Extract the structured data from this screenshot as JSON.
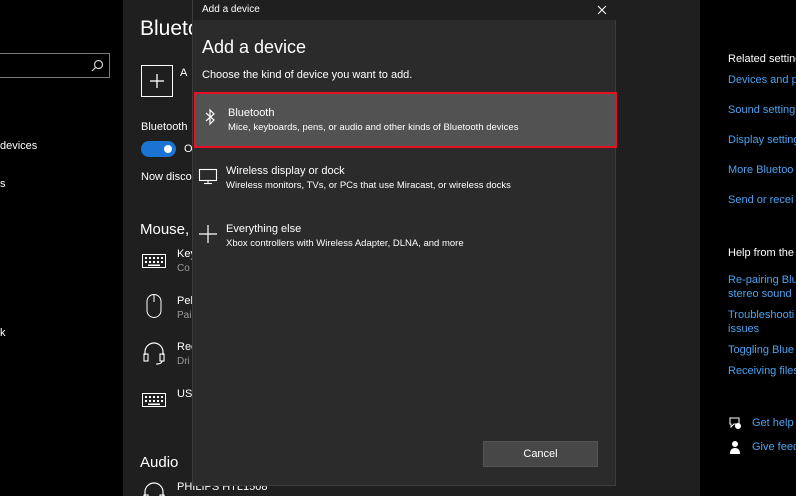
{
  "left_nav": {
    "items": [
      "devices",
      "s",
      "k"
    ]
  },
  "main": {
    "title": "Bluetooth",
    "add_label": "A",
    "bluetooth_label": "Bluetooth",
    "toggle_state": "O",
    "now_discoverable": "Now disco",
    "mouse_section": "Mouse,",
    "devices": [
      {
        "name": "Key",
        "sub": "Co",
        "icon": "keyboard-icon"
      },
      {
        "name": "Peb",
        "sub": "Pai",
        "icon": "mouse-icon"
      },
      {
        "name": "Rec",
        "sub": "Dri",
        "icon": "headset-icon"
      },
      {
        "name": "USI",
        "sub": "",
        "icon": "keyboard-icon"
      }
    ],
    "audio_section": "Audio",
    "audio_device": {
      "name": "PHILIPS HTL1508",
      "icon": "headphones-icon"
    }
  },
  "right_col": {
    "related_head": "Related setting",
    "related_links": [
      "Devices and p",
      "Sound setting",
      "Display setting",
      "More Bluetoo",
      "Send or recei"
    ],
    "help_head": "Help from the",
    "help_links": [
      "Re-pairing Blu",
      "stereo sound",
      "Troubleshooti",
      "issues",
      "Toggling Blue",
      "Receiving files"
    ],
    "get_help": "Get help",
    "give_feedback": "Give feed"
  },
  "dialog": {
    "titlebar": "Add a device",
    "heading": "Add a device",
    "subtitle": "Choose the kind of device you want to add.",
    "options": [
      {
        "title": "Bluetooth",
        "desc": "Mice, keyboards, pens, or audio and other kinds of Bluetooth devices",
        "icon": "bluetooth-icon",
        "selected": true
      },
      {
        "title": "Wireless display or dock",
        "desc": "Wireless monitors, TVs, or PCs that use Miracast, or wireless docks",
        "icon": "monitor-icon",
        "selected": false
      },
      {
        "title": "Everything else",
        "desc": "Xbox controllers with Wireless Adapter, DLNA, and more",
        "icon": "plus-icon",
        "selected": false
      }
    ],
    "cancel_label": "Cancel"
  },
  "colors": {
    "accent": "#1a75d2",
    "link": "#4aa3f0",
    "selection_border": "#e81123",
    "dialog_bg": "#2b2b2b"
  }
}
